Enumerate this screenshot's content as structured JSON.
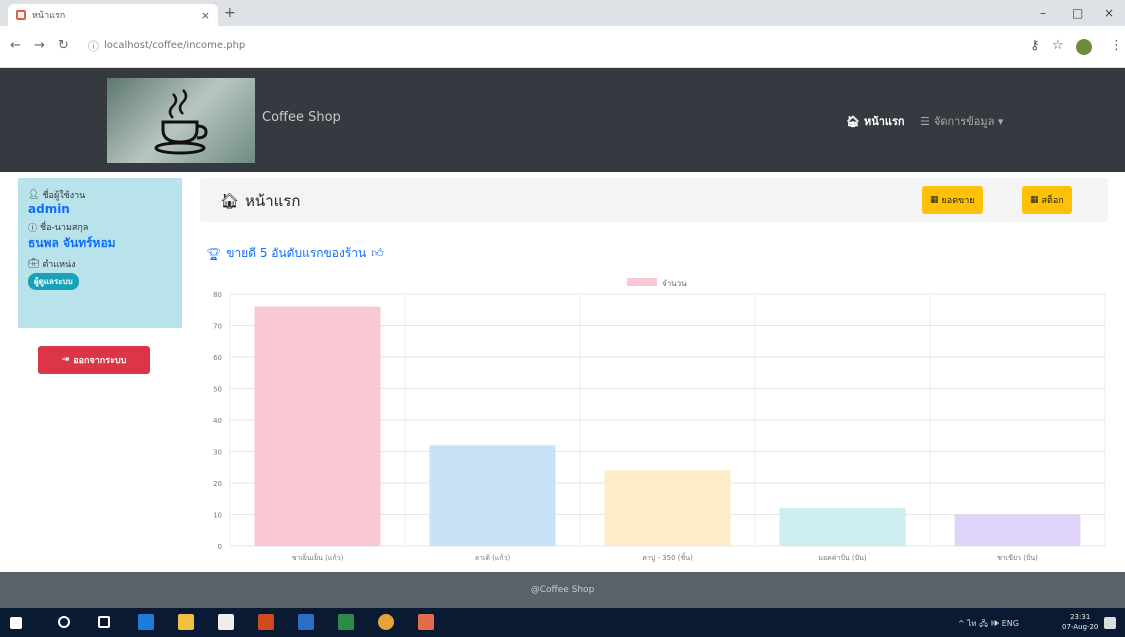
{
  "browser": {
    "tab_title": "หน้าแรก",
    "tab_close": "×",
    "new_tab": "+",
    "url": "localhost/coffee/income.php",
    "minimize": "–",
    "maximize": "□",
    "close": "×"
  },
  "header": {
    "brand": "Coffee Shop",
    "nav_home": "หน้าแรก",
    "nav_manage": "จัดการข้อมูล ▾"
  },
  "sidebar": {
    "username_label": "ชื่อผู้ใช้งาน",
    "username": "admin",
    "fullname_label": "ชื่อ-นามสกุล",
    "fullname": "ธนพล จันทร์หอม",
    "role_label": "ตำแหน่ง",
    "role": "ผู้ดูแลระบบ",
    "logout": "ออกจากระบบ"
  },
  "main": {
    "title": "หน้าแรก",
    "btn_sales": "ยอดขาย",
    "btn_stock": "สต็อก",
    "section_title": "ขายดี 5 อันดับแรกของร้าน"
  },
  "chart_data": {
    "type": "bar",
    "legend": "จำนวน",
    "categories": [
      "ชาเย็นเย็น (แก้ว)",
      "ลาเต้ (แก้ว)",
      "คาปู - 350 (ชิ้น)",
      "มอคค่าปั่น (ปั่น)",
      "ชาเขียว (ปั่น)"
    ],
    "values": [
      76,
      32,
      24,
      12,
      10
    ],
    "ylim": [
      0,
      80
    ],
    "yticks": [
      "0",
      "10",
      "20",
      "30",
      "40",
      "50",
      "60",
      "70",
      "80"
    ],
    "colors": [
      "#f8c9d3",
      "#c8e2f7",
      "#fdecc8",
      "#cdeeee",
      "#e0d4fb"
    ]
  },
  "footer": {
    "text": "@Coffee Shop"
  },
  "taskbar": {
    "tray_text": "^ ไท 🖧 🕪 ENG",
    "time": "23:31",
    "date": "07-Aug-20"
  }
}
